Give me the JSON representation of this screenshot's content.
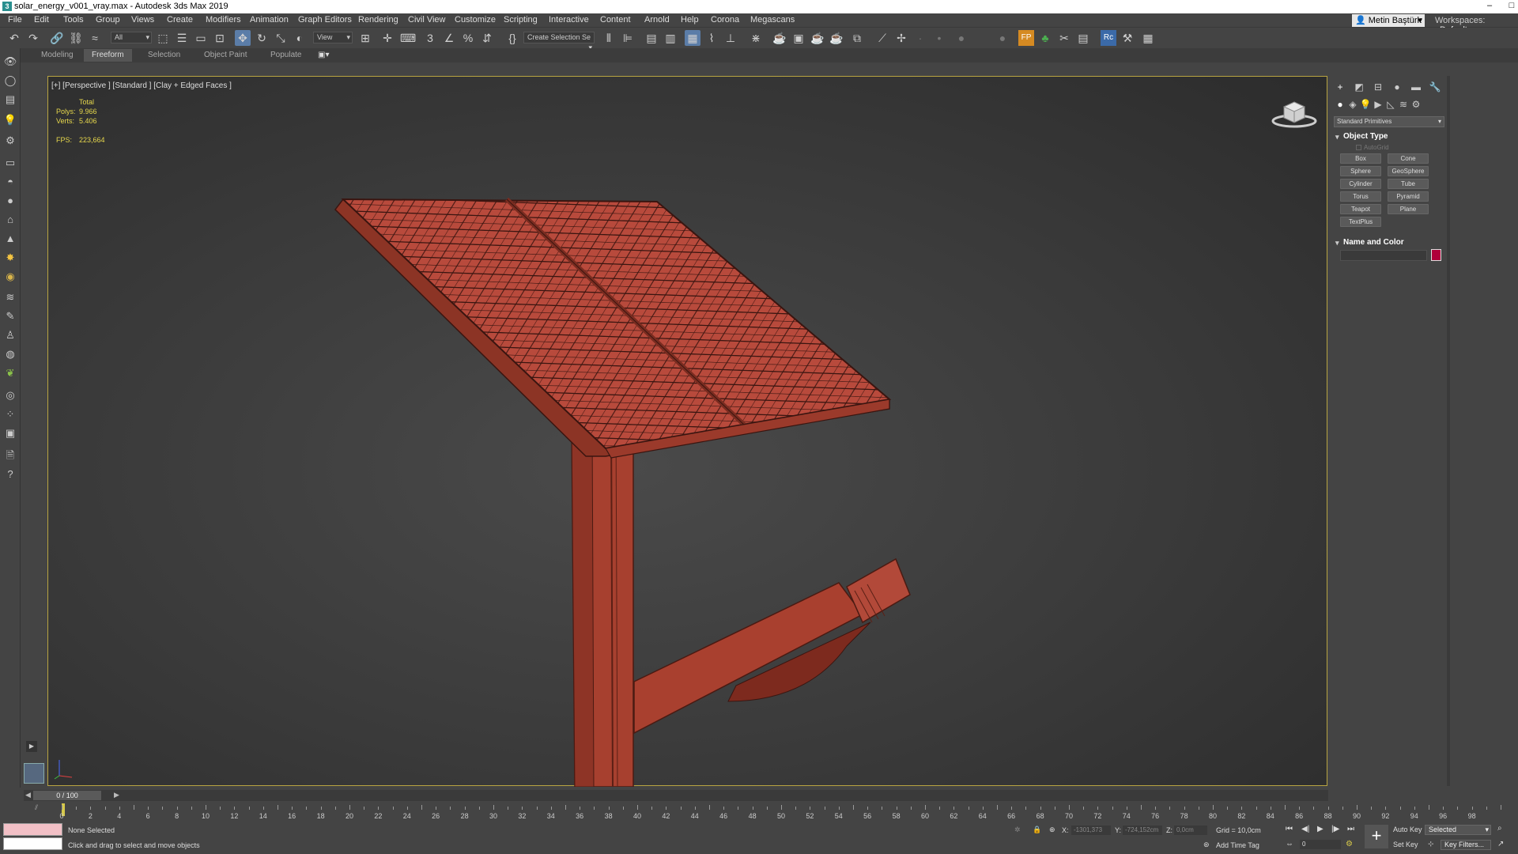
{
  "window": {
    "title": "solar_energy_v001_vray.max - Autodesk 3ds Max 2019",
    "min": "–",
    "max": "□"
  },
  "menu": [
    "File",
    "Edit",
    "Tools",
    "Group",
    "Views",
    "Create",
    "Modifiers",
    "Animation",
    "Graph Editors",
    "Rendering",
    "Civil View",
    "Customize",
    "Scripting",
    "Interactive",
    "Content",
    "Arnold",
    "Help",
    "Corona",
    "Megascans"
  ],
  "user": {
    "name": "Metin Baştürk",
    "workspace_label": "Workspaces:",
    "workspace_value": "Default"
  },
  "toolbar": {
    "selection_filter": "All",
    "ref_coord": "View",
    "named_selection": "Create Selection Se",
    "active_tool": "select-move"
  },
  "ribbon": {
    "tabs": [
      "Modeling",
      "Freeform",
      "Selection",
      "Object Paint",
      "Populate"
    ],
    "active": "Freeform"
  },
  "viewport": {
    "label": "[+] [Perspective ] [Standard ] [Clay + Edged Faces ]",
    "stats": {
      "total_label": "Total",
      "polys_label": "Polys:",
      "polys": "9.966",
      "verts_label": "Verts:",
      "verts": "5.406",
      "fps_label": "FPS:",
      "fps": "223,664"
    },
    "model_color": "#b54a3a",
    "frame_color": "#b8a441"
  },
  "command_panel": {
    "category": "Standard Primitives",
    "object_type_title": "Object Type",
    "autogrid": "AutoGrid",
    "buttons": [
      "Box",
      "Cone",
      "Sphere",
      "GeoSphere",
      "Cylinder",
      "Tube",
      "Torus",
      "Pyramid",
      "Teapot",
      "Plane",
      "TextPlus"
    ],
    "name_color_title": "Name and Color",
    "object_color": "#b0003a"
  },
  "timeline": {
    "frame": "0 / 100",
    "ticks": [
      0,
      2,
      4,
      6,
      8,
      10,
      12,
      14,
      16,
      18,
      20,
      22,
      24,
      26,
      28,
      30,
      32,
      34,
      36,
      38,
      40,
      42,
      44,
      46,
      48,
      50,
      52,
      54,
      56,
      58,
      60,
      62,
      64,
      66,
      68,
      70,
      72,
      74,
      76,
      78,
      80,
      82,
      84,
      86,
      88,
      90,
      92,
      94,
      96,
      98
    ]
  },
  "status": {
    "selection": "None Selected",
    "prompt": "Click and drag to select and move objects",
    "x_label": "X:",
    "x": "-1301,373",
    "y_label": "Y:",
    "y": "-724,152cm",
    "z_label": "Z:",
    "z": "0,0cm",
    "grid": "Grid = 10,0cm",
    "add_time_tag": "Add Time Tag",
    "auto_key": "Auto Key",
    "set_key": "Set Key",
    "key_mode": "Selected",
    "key_filters": "Key Filters...",
    "current_frame": "0"
  }
}
